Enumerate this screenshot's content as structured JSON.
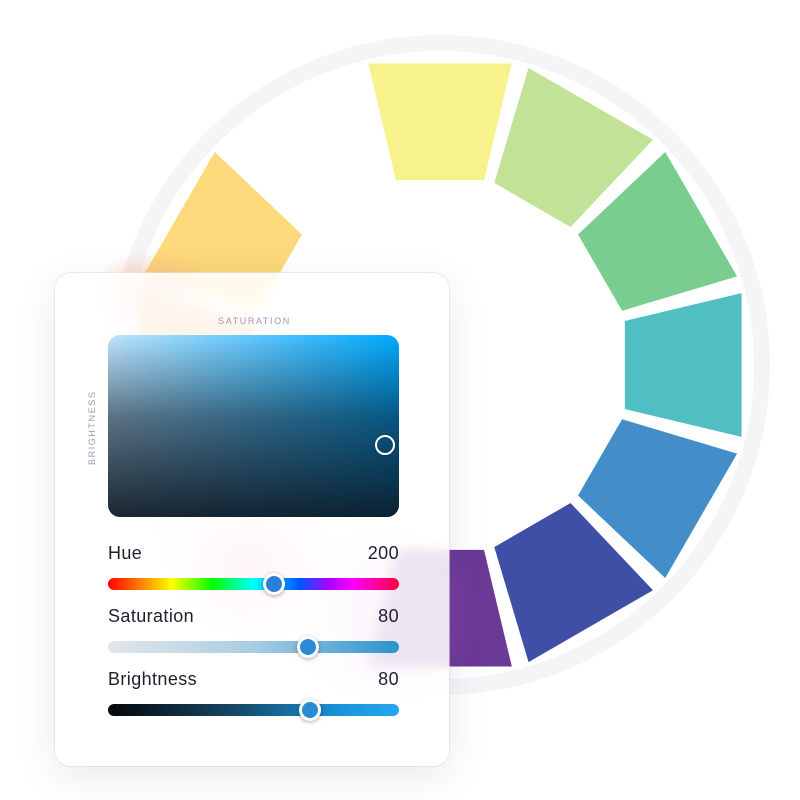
{
  "picker": {
    "axis_saturation": "SATURATION",
    "axis_brightness": "BRIGHTNESS",
    "base_color": "#00aaff",
    "cursor_color": "#ffffff",
    "sliders": [
      {
        "label": "Hue",
        "value": "200",
        "fraction": 0.571,
        "thumb_color": "#2b7fd6"
      },
      {
        "label": "Saturation",
        "value": "80",
        "fraction": 0.688,
        "thumb_color": "#2b8ad6"
      },
      {
        "label": "Brightness",
        "value": "80",
        "fraction": 0.695,
        "thumb_color": "#2b8ad6"
      }
    ]
  },
  "color_wheel": {
    "segments": [
      {
        "name": "yellow",
        "color": "#f7f28a"
      },
      {
        "name": "yellow-green",
        "color": "#c2e397"
      },
      {
        "name": "green",
        "color": "#78cd8f"
      },
      {
        "name": "teal",
        "color": "#50bfc4"
      },
      {
        "name": "blue",
        "color": "#438dc9"
      },
      {
        "name": "indigo",
        "color": "#3f4fa5"
      },
      {
        "name": "purple",
        "color": "#6b3996"
      },
      {
        "name": "orange",
        "color": "#fbb474"
      },
      {
        "name": "yellow-orange",
        "color": "#fcd97a"
      }
    ]
  }
}
